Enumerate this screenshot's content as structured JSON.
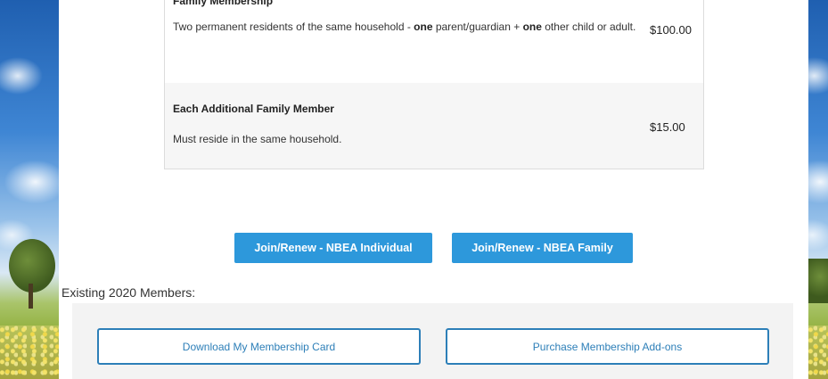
{
  "pricing": {
    "family": {
      "title": "Family Membership",
      "desc_parts": {
        "part1": "Two permanent residents of the same household - ",
        "bold1": "one",
        "part2": " parent/guardian + ",
        "bold2": "one",
        "part3": " other child or adult."
      },
      "price": "$100.00"
    },
    "additional": {
      "title": "Each Additional Family Member",
      "desc": "Must reside in the same household.",
      "price": "$15.00"
    }
  },
  "join": {
    "individual_label": "Join/Renew - NBEA Individual",
    "family_label": "Join/Renew - NBEA Family"
  },
  "existing": {
    "label": "Existing 2020 Members:",
    "download_label": "Download My Membership Card",
    "addons_label": "Purchase Membership Add-ons"
  },
  "colors": {
    "primary_button": "#2d98db",
    "outline_button": "#2d7fb8",
    "panel_bg": "#f3f3f3"
  }
}
